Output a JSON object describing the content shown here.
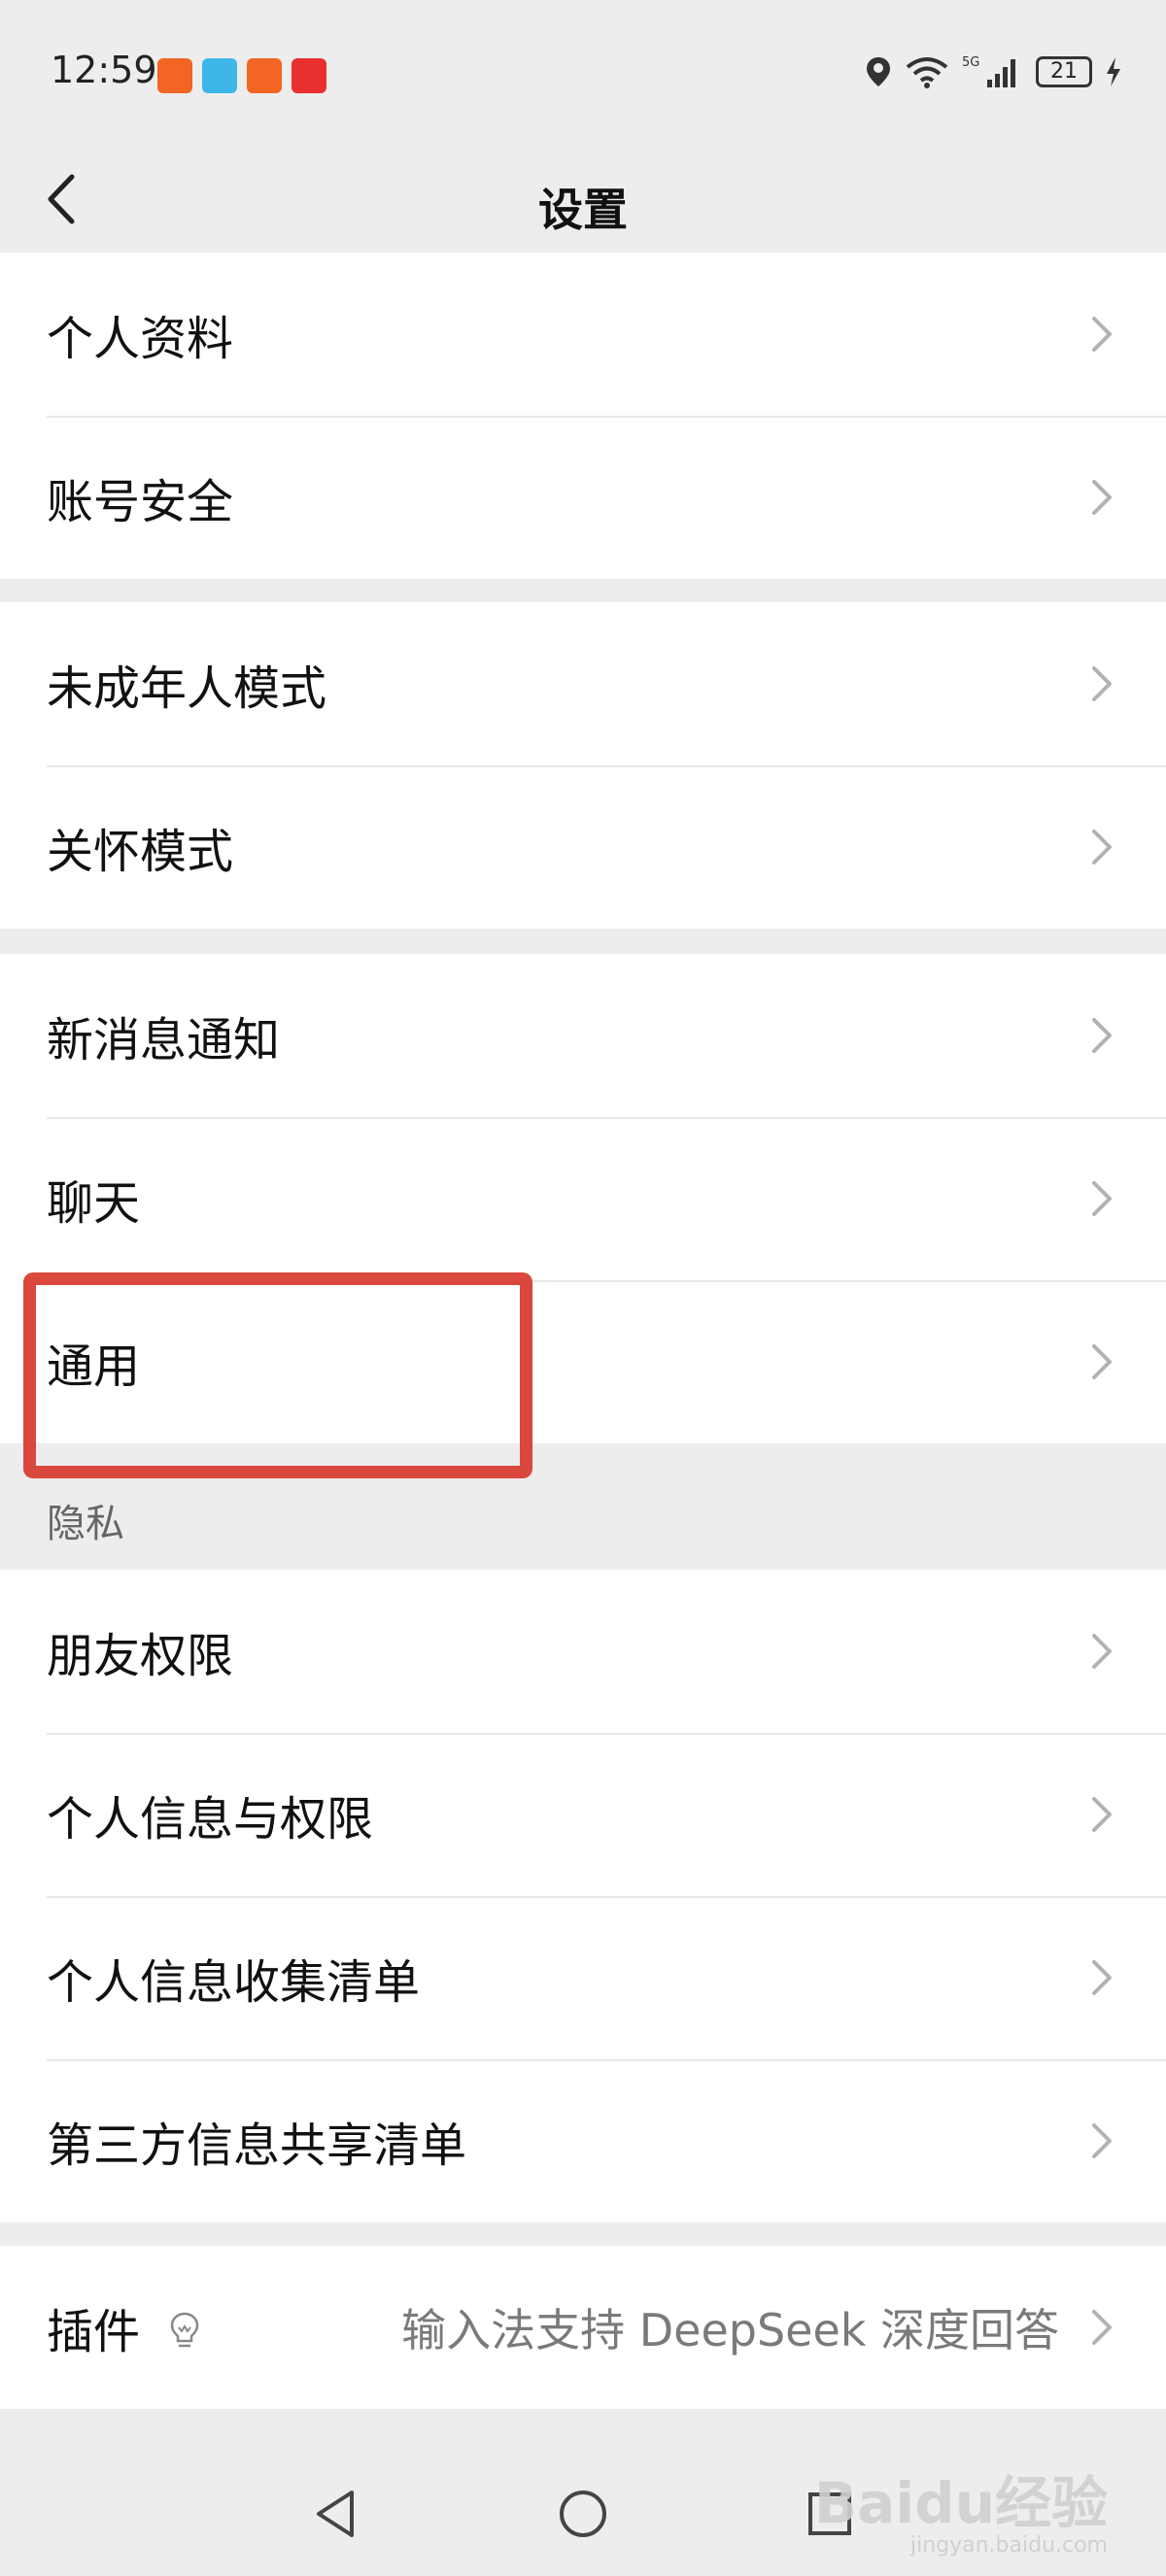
{
  "status_bar": {
    "time": "12:59",
    "network": "5G",
    "battery": "21"
  },
  "nav": {
    "title": "设置"
  },
  "groups": [
    {
      "items": [
        {
          "label": "个人资料"
        },
        {
          "label": "账号安全"
        }
      ]
    },
    {
      "items": [
        {
          "label": "未成年人模式"
        },
        {
          "label": "关怀模式"
        }
      ]
    },
    {
      "items": [
        {
          "label": "新消息通知"
        },
        {
          "label": "聊天"
        },
        {
          "label": "通用"
        }
      ]
    }
  ],
  "privacy": {
    "header": "隐私",
    "items": [
      {
        "label": "朋友权限"
      },
      {
        "label": "个人信息与权限"
      },
      {
        "label": "个人信息收集清单"
      },
      {
        "label": "第三方信息共享清单"
      }
    ]
  },
  "plugin": {
    "label": "插件",
    "value": "输入法支持 DeepSeek 深度回答"
  },
  "watermark": {
    "main": "Baidu经验",
    "sub": "jingyan.baidu.com"
  },
  "colors": {
    "background": "#ededed",
    "highlight": "#d9473d"
  }
}
